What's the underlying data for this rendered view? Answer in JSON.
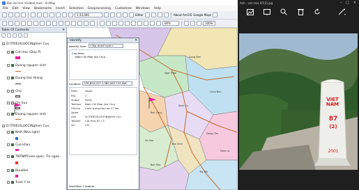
{
  "window": {
    "title": "Ban do tinh (Visible).mxd - ArcMap"
  },
  "menu": [
    "File",
    "Edit",
    "View",
    "Bookmarks",
    "Insert",
    "Selection",
    "Geoprocessing",
    "Customize",
    "Windows",
    "Help"
  ],
  "toolbar": {
    "scale": "1:33,000",
    "editor_label": "Editor",
    "about_label": "About ArcGIS",
    "google_maps_label": "Google Maps",
    "zoom_level": "60%",
    "zoom_level2": "100%"
  },
  "toc": {
    "header": "Table Of Contents",
    "layers": [
      {
        "label": "D:\\TRIEU\\LUOC\\Nghien Cuu",
        "type": "folder"
      },
      {
        "label": "Cot moc (Day P)",
        "type": "check"
      },
      {
        "label": "Duong nguyen vinh",
        "type": "check"
      },
      {
        "label": "Duong bac thang",
        "type": "check"
      },
      {
        "label": "Cho",
        "type": "check"
      },
      {
        "label": "Chi huu",
        "type": "check"
      },
      {
        "label": "Duong nguyen vinh",
        "type": "check"
      },
      {
        "label": "D:\\TRIEU\\LUOC\\Nghien Cuu",
        "type": "folder"
      },
      {
        "label": "NHA (Nha nghi)",
        "type": "check"
      },
      {
        "label": "Cua khau",
        "type": "check"
      },
      {
        "label": "TNTNMTvien ques: Tin ngaa",
        "type": "check"
      },
      {
        "label": "Buudien",
        "type": "check"
      },
      {
        "label": "Tram Y te",
        "type": "check"
      }
    ]
  },
  "identify": {
    "title": "Identify",
    "from_label": "Identify from:",
    "from_value": "<Top-most layer>",
    "tree_root": "Cua khau",
    "tree_child": "Nam Chi Mop (An Chu)",
    "location_label": "Location:",
    "location_value": "378,654.027  2,380,963.743 Met",
    "columns": [
      "Field",
      "Value"
    ],
    "rows": [
      {
        "field": "FID",
        "value": "1"
      },
      {
        "field": "Shape",
        "value": "Point"
      },
      {
        "field": "Tenmoc",
        "value": "Nam Chi Mop (An Chu)"
      },
      {
        "field": "Ghichu",
        "value": "Cach trung tam xa 17 km"
      },
      {
        "field": "Value",
        "value": ""
      },
      {
        "field": "Anh",
        "value": "D:\\TRIEU\\LUOC\\Nghien Cuu"
      },
      {
        "field": "Tenanh",
        "value": "Cot moc 87 / 2"
      },
      {
        "field": "Xa",
        "value": "Chi"
      }
    ],
    "status": "Identified 1 feature"
  },
  "map": {
    "labels": [
      "Ngo Thao",
      "Dong Ban",
      "Lung Ban",
      "Nam Cu",
      "Dong Chu",
      "Tam Vinh",
      "Ban Moc",
      "Tay Mo",
      "Bac Cong",
      "Vu Hoa",
      "Nam La"
    ]
  },
  "viewer": {
    "title": "Anh - cot moc 87(2).jpg",
    "marker_text": "VIET NAM",
    "marker_number": "87",
    "marker_sub": "(2)",
    "marker_year": "2001"
  },
  "colors": {
    "map_road": "#c26a2c",
    "marker": "#e81ea0",
    "viewer_bg": "#1f1f1f"
  }
}
